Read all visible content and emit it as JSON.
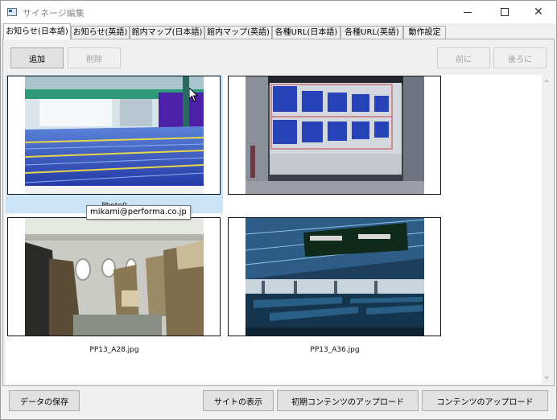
{
  "window": {
    "title": "サイネージ編集",
    "controls": {
      "close": "✕"
    }
  },
  "tabs": [
    {
      "label": "お知らせ(日本語)",
      "active": true
    },
    {
      "label": "お知らせ(英語)",
      "active": false
    },
    {
      "label": "館内マップ(日本語)",
      "active": false
    },
    {
      "label": "館内マップ(英語)",
      "active": false
    },
    {
      "label": "各種URL(日本語)",
      "active": false
    },
    {
      "label": "各種URL(英語)",
      "active": false
    },
    {
      "label": "動作設定",
      "active": false
    }
  ],
  "toolbar": {
    "add_label": "追加",
    "delete_label": "削除",
    "prev_label": "前に",
    "next_label": "後ろに"
  },
  "gallery": {
    "items": [
      {
        "caption": "Photo0",
        "image": "indoor-pool-icon",
        "selected": true
      },
      {
        "caption": "",
        "image": "flight-board-icon",
        "selected": false
      },
      {
        "caption": "PP13_A28.jpg",
        "image": "airplane-cabin-icon",
        "selected": false
      },
      {
        "caption": "PP13_A36.jpg",
        "image": "airport-terminal-icon",
        "selected": false
      }
    ],
    "tooltip": "mikami@performa.co.jp"
  },
  "footer": {
    "save_label": "データの保存",
    "show_site_label": "サイトの表示",
    "upload_initial_label": "初期コンテンツのアップロード",
    "upload_label": "コンテンツのアップロード"
  }
}
